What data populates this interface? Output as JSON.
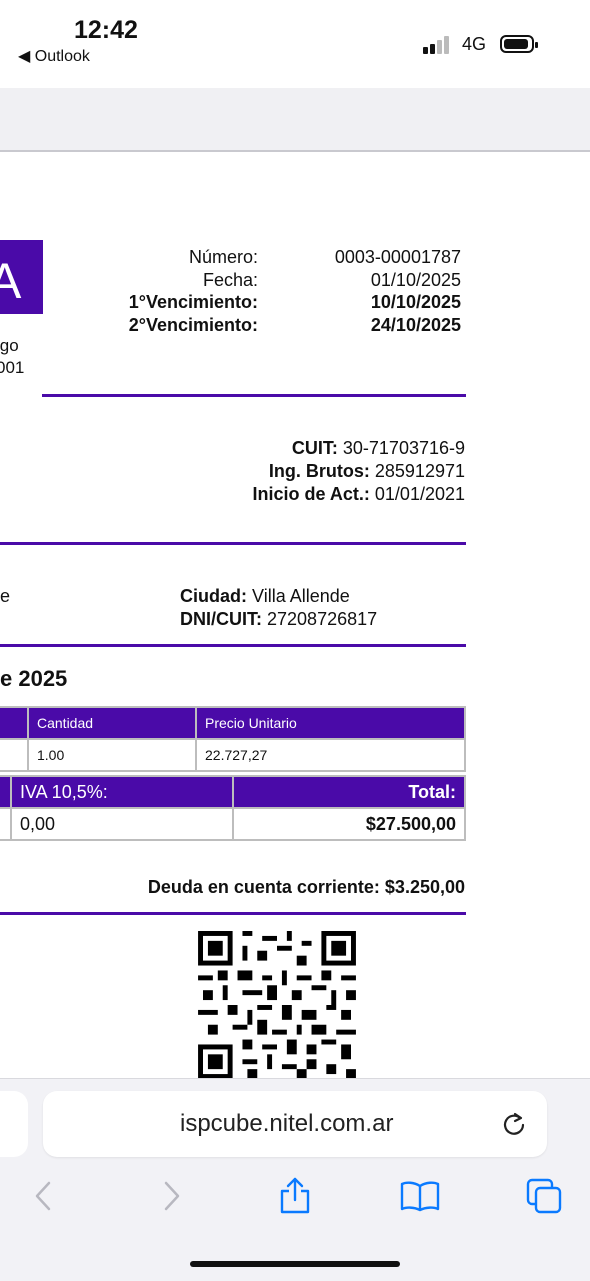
{
  "status_bar": {
    "time": "12:42",
    "back_label": "◀ Outlook",
    "network": "4G"
  },
  "invoice": {
    "header_labels": [
      "Número:",
      "Fecha:",
      "1°Vencimiento:",
      "2°Vencimiento:"
    ],
    "header_values": [
      "0003-00001787",
      "01/10/2025",
      "10/10/2025",
      "24/10/2025"
    ],
    "logo_letter": "A",
    "clipped_left_lines": [
      "igo",
      "001"
    ],
    "cuit_label": "CUIT:",
    "cuit_value": "30-71703716-9",
    "ingbrutos_label": "Ing. Brutos:",
    "ingbrutos_value": "285912971",
    "inicio_label": "Inicio de Act.:",
    "inicio_value": "01/01/2021",
    "client_left_clip": "e",
    "ciudad_label": "Ciudad:",
    "ciudad_value": "Villa Allende",
    "dni_label": "DNI/CUIT:",
    "dni_value": "27208726817",
    "period_title": "e 2025",
    "table1": {
      "headers": [
        "Cantidad",
        "Precio Unitario"
      ],
      "row": [
        "1.00",
        "22.727,27"
      ]
    },
    "table2": {
      "headers": [
        "IVA 10,5%:",
        "Total:"
      ],
      "row": [
        "0,00",
        "$27.500,00"
      ]
    },
    "deuda": "Deuda en cuenta corriente: $3.250,00"
  },
  "browser": {
    "url": "ispcube.nitel.com.ar"
  },
  "colors": {
    "accent": "#4a0aa8",
    "ios_blue": "#0a7aff"
  }
}
